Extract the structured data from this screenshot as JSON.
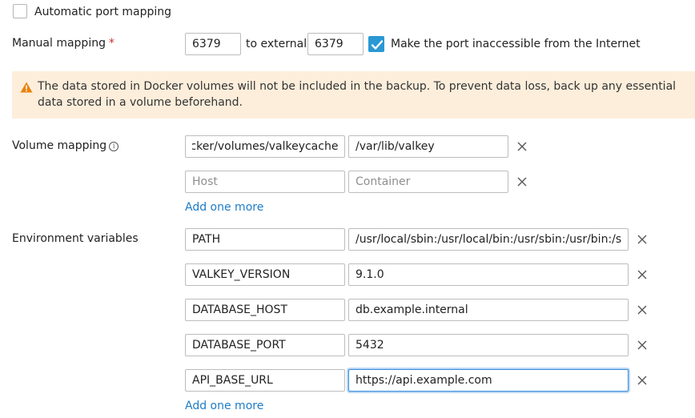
{
  "port": {
    "auto_mapping_label": "Automatic port mapping",
    "manual_mapping_label": "Manual mapping",
    "required_mark": "*",
    "internal_port": "6379",
    "to_external_label": "to external",
    "external_port": "6379",
    "inaccessible_label": "Make the port inaccessible from the Internet",
    "auto_mapping_checked": false,
    "inaccessible_checked": true
  },
  "warning": {
    "text": "The data stored in Docker volumes will not be included in the backup. To prevent data loss, back up any essential data stored in a volume beforehand.",
    "icon": "warning-icon"
  },
  "volumes": {
    "label": "Volume mapping",
    "rows": [
      {
        "host": "locker/volumes/valkeycache",
        "container": "/var/lib/valkey"
      }
    ],
    "host_placeholder": "Host",
    "container_placeholder": "Container",
    "add_label": "Add one more"
  },
  "env": {
    "label": "Environment variables",
    "rows": [
      {
        "name": "PATH",
        "value": "/usr/local/sbin:/usr/local/bin:/usr/sbin:/usr/bin:/sbin:/bin"
      },
      {
        "name": "VALKEY_VERSION",
        "value": "9.1.0"
      },
      {
        "name": "DATABASE_HOST",
        "value": "db.example.internal"
      },
      {
        "name": "DATABASE_PORT",
        "value": "5432"
      },
      {
        "name": "API_BASE_URL",
        "value": "https://api.example.com"
      }
    ],
    "add_label": "Add one more"
  },
  "colors": {
    "accent": "#2a98d3",
    "link": "#1d7cc7",
    "warning_bg": "#fdeedb",
    "warning_icon": "#e8820c",
    "required": "#d02c2c"
  }
}
